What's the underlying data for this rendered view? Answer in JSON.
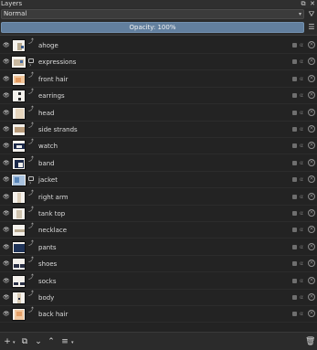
{
  "window": {
    "title": "Layers",
    "float_icon": "float-icon",
    "close_icon": "close-icon"
  },
  "blend_mode": {
    "value": "Normal"
  },
  "filter": {
    "icon": "filter-icon"
  },
  "opacity": {
    "label": "Opacity:  100%",
    "value_percent": 100
  },
  "layers": [
    {
      "name": "ahoge",
      "visible": true,
      "type": "paint",
      "thumb": "hair-sketch"
    },
    {
      "name": "expressions",
      "visible": true,
      "type": "group",
      "thumb": "face-sketch"
    },
    {
      "name": "front hair",
      "visible": true,
      "type": "paint",
      "thumb": "hair-orange"
    },
    {
      "name": "earrings",
      "visible": true,
      "type": "paint",
      "thumb": "dots-dark"
    },
    {
      "name": "head",
      "visible": true,
      "type": "paint",
      "thumb": "head-sketch"
    },
    {
      "name": "side strands",
      "visible": true,
      "type": "paint",
      "thumb": "strands-sketch"
    },
    {
      "name": "watch",
      "visible": true,
      "type": "paint",
      "thumb": "watch-dark"
    },
    {
      "name": "band",
      "visible": true,
      "type": "paint",
      "thumb": "band-dark"
    },
    {
      "name": "jacket",
      "visible": true,
      "type": "group",
      "thumb": "jacket-blue"
    },
    {
      "name": "right arm",
      "visible": true,
      "type": "paint",
      "thumb": "arm-sketch"
    },
    {
      "name": "tank top",
      "visible": true,
      "type": "paint",
      "thumb": "top-sketch"
    },
    {
      "name": "necklace",
      "visible": true,
      "type": "paint",
      "thumb": "necklace-sketch"
    },
    {
      "name": "pants",
      "visible": true,
      "type": "paint",
      "thumb": "pants-navy"
    },
    {
      "name": "shoes",
      "visible": true,
      "type": "paint",
      "thumb": "shoes-dark"
    },
    {
      "name": "socks",
      "visible": true,
      "type": "paint",
      "thumb": "socks-dark"
    },
    {
      "name": "body",
      "visible": true,
      "type": "paint",
      "thumb": "body-sketch"
    },
    {
      "name": "back hair",
      "visible": true,
      "type": "paint",
      "thumb": "backhair-orange"
    }
  ],
  "layer_icons": {
    "eye": "eye-icon",
    "lock": "lock-icon",
    "alpha": "alpha-lock-icon",
    "inherit": "inherit-alpha-icon"
  },
  "toolbar": {
    "add": "plus-icon",
    "duplicate": "duplicate-icon",
    "move_down": "chevron-down-icon",
    "move_up": "chevron-up-icon",
    "properties": "properties-icon",
    "delete": "trash-icon"
  },
  "colors": {
    "panel_bg": "#2b2b2b",
    "list_bg": "#232323",
    "opacity_bar": "#627f9e",
    "text": "#dcdcdc"
  }
}
